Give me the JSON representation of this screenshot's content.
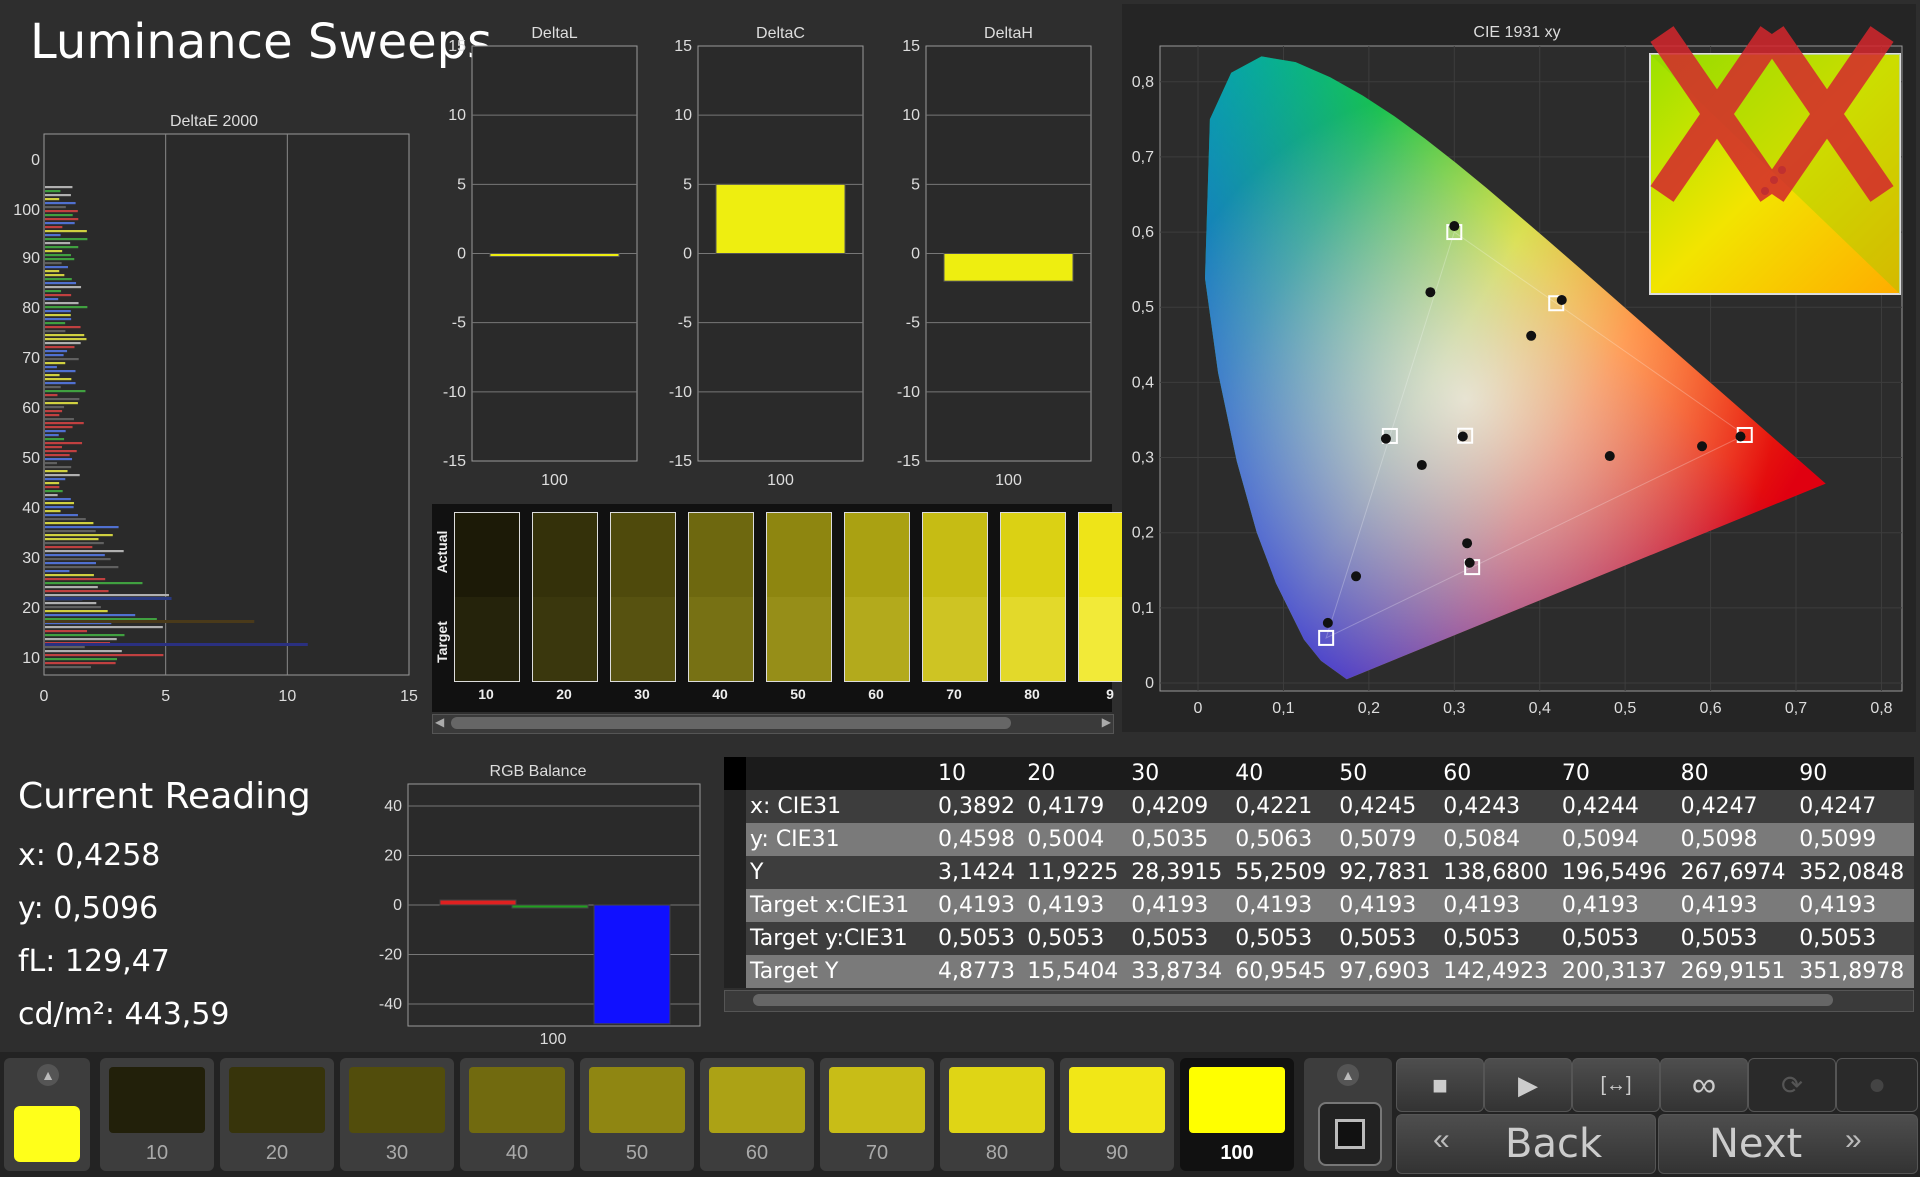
{
  "page": {
    "title": "Luminance Sweeps"
  },
  "deltae": {
    "title": "DeltaE 2000",
    "yticks": [
      "0",
      "100",
      "90",
      "80",
      "70",
      "60",
      "50",
      "40",
      "30",
      "20",
      "10"
    ],
    "xticks": [
      "0",
      "5",
      "10",
      "15"
    ]
  },
  "deltaL": {
    "title": "DeltaL",
    "xlabel": "100",
    "value": 0.0
  },
  "deltaC": {
    "title": "DeltaC",
    "xlabel": "100",
    "value": 5.0
  },
  "deltaH": {
    "title": "DeltaH",
    "xlabel": "100",
    "value": -2.0
  },
  "delta_yticks": [
    "15",
    "10",
    "5",
    "0",
    "-5",
    "-10",
    "-15"
  ],
  "compare": {
    "actual_label": "Actual",
    "target_label": "Target",
    "steps": [
      "10",
      "20",
      "30",
      "40",
      "50",
      "60",
      "70",
      "80",
      "9"
    ],
    "actual_colors": [
      "#1c1a07",
      "#34310a",
      "#4f4a0c",
      "#6e680f",
      "#8e8610",
      "#aaa112",
      "#c6bc14",
      "#dbd114",
      "#eee418"
    ],
    "target_colors": [
      "#25230b",
      "#3a370d",
      "#575210",
      "#777114",
      "#968e18",
      "#b3aa1c",
      "#cec423",
      "#e3d92a",
      "#f2ea38"
    ]
  },
  "cie": {
    "title": "CIE 1931 xy",
    "xticks": [
      "0",
      "0,1",
      "0,2",
      "0,3",
      "0,4",
      "0,5",
      "0,6",
      "0,7",
      "0,8"
    ],
    "yticks": [
      "0",
      "0,1",
      "0,2",
      "0,3",
      "0,4",
      "0,5",
      "0,6",
      "0,7",
      "0,8"
    ]
  },
  "rgb": {
    "title": "RGB Balance",
    "yticks": [
      "40",
      "20",
      "0",
      "-20",
      "-40"
    ],
    "xlabel": "100",
    "red": 2,
    "green": -1,
    "blue": -48
  },
  "reading": {
    "title": "Current Reading",
    "x": "x: 0,4258",
    "y": "y: 0,5096",
    "fl": "fL: 129,47",
    "cd": "cd/m²: 443,59"
  },
  "table": {
    "headers": [
      "10",
      "20",
      "30",
      "40",
      "50",
      "60",
      "70",
      "80",
      "90"
    ],
    "rows": [
      {
        "label": "x: CIE31",
        "values": [
          "0,3892",
          "0,4179",
          "0,4209",
          "0,4221",
          "0,4245",
          "0,4243",
          "0,4244",
          "0,4247",
          "0,4247"
        ]
      },
      {
        "label": "y: CIE31",
        "values": [
          "0,4598",
          "0,5004",
          "0,5035",
          "0,5063",
          "0,5079",
          "0,5084",
          "0,5094",
          "0,5098",
          "0,5099"
        ]
      },
      {
        "label": "Y",
        "values": [
          "3,1424",
          "11,9225",
          "28,3915",
          "55,2509",
          "92,7831",
          "138,6800",
          "196,5496",
          "267,6974",
          "352,0848"
        ]
      },
      {
        "label": "Target x:CIE31",
        "values": [
          "0,4193",
          "0,4193",
          "0,4193",
          "0,4193",
          "0,4193",
          "0,4193",
          "0,4193",
          "0,4193",
          "0,4193"
        ]
      },
      {
        "label": "Target y:CIE31",
        "values": [
          "0,5053",
          "0,5053",
          "0,5053",
          "0,5053",
          "0,5053",
          "0,5053",
          "0,5053",
          "0,5053",
          "0,5053"
        ]
      },
      {
        "label": "Target Y",
        "values": [
          "4,8773",
          "15,5404",
          "33,8734",
          "60,9545",
          "97,6903",
          "142,4923",
          "200,3137",
          "269,9151",
          "351,8978"
        ]
      }
    ]
  },
  "swatches": {
    "items": [
      {
        "label": "10",
        "color": "#22200a"
      },
      {
        "label": "20",
        "color": "#37340b"
      },
      {
        "label": "30",
        "color": "#524d0c"
      },
      {
        "label": "40",
        "color": "#716a0f"
      },
      {
        "label": "50",
        "color": "#8f8612"
      },
      {
        "label": "60",
        "color": "#aca215"
      },
      {
        "label": "70",
        "color": "#c8bd17"
      },
      {
        "label": "80",
        "color": "#dfd515"
      },
      {
        "label": "90",
        "color": "#f1e717"
      },
      {
        "label": "100",
        "color": "#ffff00"
      }
    ],
    "current_color": "#ffff1a"
  },
  "nav": {
    "back_label": "Back",
    "next_label": "Next"
  }
}
